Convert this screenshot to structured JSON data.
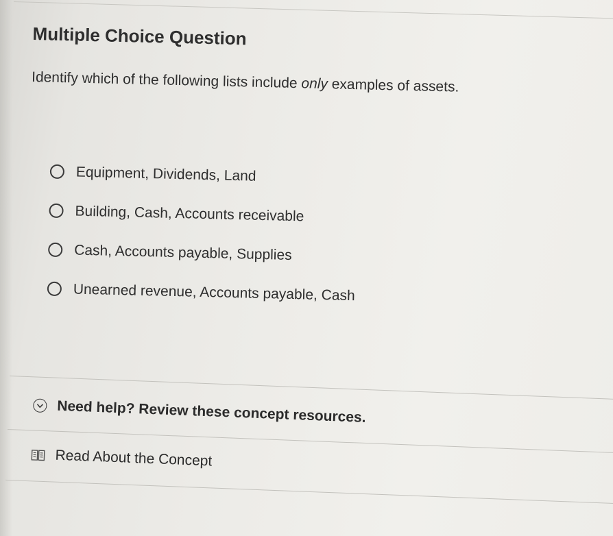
{
  "question": {
    "heading": "Multiple Choice Question",
    "prompt_before": "Identify which of the following lists include ",
    "prompt_emphasis": "only",
    "prompt_after": " examples of assets."
  },
  "options": [
    {
      "label": "Equipment, Dividends, Land",
      "selected": false
    },
    {
      "label": "Building, Cash, Accounts receivable",
      "selected": false
    },
    {
      "label": "Cash, Accounts payable, Supplies",
      "selected": false
    },
    {
      "label": "Unearned revenue, Accounts payable, Cash",
      "selected": false
    }
  ],
  "help": {
    "title": "Need help? Review these concept resources.",
    "toggle_icon": "chevron-down-circle-icon",
    "resource_icon": "book-icon",
    "resource_label": "Read About the Concept"
  }
}
